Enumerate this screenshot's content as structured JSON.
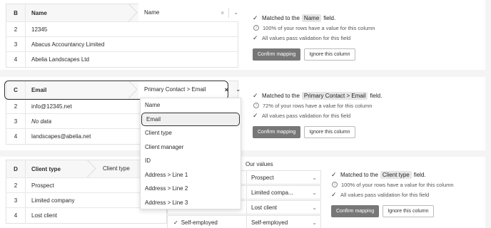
{
  "col_b": {
    "letter": "B",
    "header": "Name",
    "mapped": "Name",
    "rows": [
      {
        "idx": "2",
        "value": "12345"
      },
      {
        "idx": "3",
        "value": "Abacus Accountancy Limited"
      },
      {
        "idx": "4",
        "value": "Abelia Landscapes Ltd"
      }
    ],
    "status": {
      "matched_prefix": "Matched to the",
      "matched_field": "Name",
      "matched_suffix": "field.",
      "coverage": "100% of your rows have a value for this column",
      "validation": "All values pass validation for this field"
    }
  },
  "col_c": {
    "letter": "C",
    "header": "Email",
    "mapped": "Primary Contact > Email",
    "rows": [
      {
        "idx": "2",
        "value": "info@12345.net"
      },
      {
        "idx": "3",
        "value": "No data"
      },
      {
        "idx": "4",
        "value": "landscapes@abelia.net"
      }
    ],
    "status": {
      "matched_prefix": "Matched to the",
      "matched_field": "Primary Contact > Email",
      "matched_suffix": "field.",
      "coverage": "72% of your rows have a value for this column",
      "validation": "All values pass validation for this field"
    },
    "dropdown": [
      "Name",
      "Email",
      "Client type",
      "Client manager",
      "ID",
      "Address > Line 1",
      "Address > Line 2",
      "Address > Line 3"
    ]
  },
  "col_d": {
    "letter": "D",
    "header": "Client type",
    "mapped": "Client type",
    "rows": [
      {
        "idx": "2",
        "value": "Prospect"
      },
      {
        "idx": "3",
        "value": "Limited company"
      },
      {
        "idx": "4",
        "value": "Lost client"
      }
    ],
    "values_header": "Our values",
    "value_map": [
      {
        "theirs": "",
        "ours": "Prospect"
      },
      {
        "theirs": "",
        "ours": "Limited compa..."
      },
      {
        "theirs": "Lost client",
        "ours": "Lost client"
      },
      {
        "theirs": "Self-employed",
        "ours": "Self-employed"
      }
    ],
    "status": {
      "matched_prefix": "Matched to the",
      "matched_field": "Client type",
      "matched_suffix": "field.",
      "coverage": "100% of your rows have a value for this column",
      "validation": "All values pass validation for this field"
    }
  },
  "buttons": {
    "confirm": "Confirm mapping",
    "ignore": "Ignore this column"
  },
  "icons": {
    "tick": "✓",
    "info": "i",
    "clear": "×",
    "chevron": "⌄"
  }
}
